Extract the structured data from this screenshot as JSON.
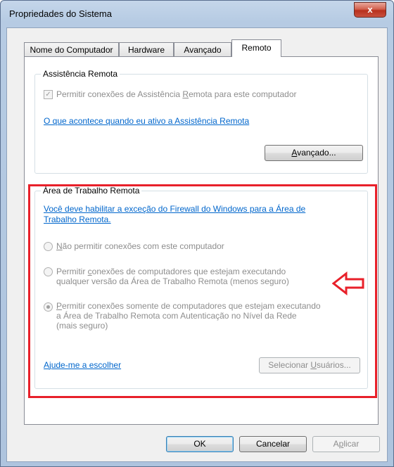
{
  "window": {
    "title": "Propriedades do Sistema",
    "close_label": "x"
  },
  "tabs": [
    {
      "label": "Nome do Computador"
    },
    {
      "label": "Hardware"
    },
    {
      "label": "Avançado"
    },
    {
      "label": "Remoto"
    }
  ],
  "assistencia": {
    "group_title": "Assistência Remota",
    "checkbox_label_pre": "Permitir conexões de Assistência ",
    "checkbox_label_u": "R",
    "checkbox_label_post": "emota para este computador",
    "checkbox_checked": true,
    "link_text": "O que acontece quando eu ativo a Assistência Remota",
    "advanced_pre": "",
    "advanced_u": "A",
    "advanced_post": "vançado..."
  },
  "area_trabalho": {
    "group_title": "Área de Trabalho Remota",
    "firewall_link_line1": "Você deve habilitar a exceção do Firewall do Windows para a Área de",
    "firewall_link_line2": "Trabalho Remota.",
    "option1_u": "N",
    "option1_post": "ão permitir conexões com este computador",
    "option2_line1_pre": "Permitir ",
    "option2_line1_u": "c",
    "option2_line1_post": "onexões de computadores que estejam executando",
    "option2_line2": "qualquer versão da Área de Trabalho Remota (menos seguro)",
    "option3_line1_u": "P",
    "option3_line1_post": "ermitir conexões somente de computadores que estejam executando",
    "option3_line2": "a Área de Trabalho Remota com Autenticação no Nível da Rede",
    "option3_line3": "(mais seguro)",
    "selected_option": 3,
    "help_link_pre": "A",
    "help_link_u": "j",
    "help_link_post": "ude-me a escolher",
    "select_users_pre": "Selecionar ",
    "select_users_u": "U",
    "select_users_post": "suários..."
  },
  "footer": {
    "ok_label": "OK",
    "cancel_label": "Cancelar",
    "apply_pre": "A",
    "apply_u": "p",
    "apply_post": "licar"
  },
  "colors": {
    "highlight": "#e8202a",
    "arrow": "#e8202a",
    "link": "#0066cc"
  }
}
